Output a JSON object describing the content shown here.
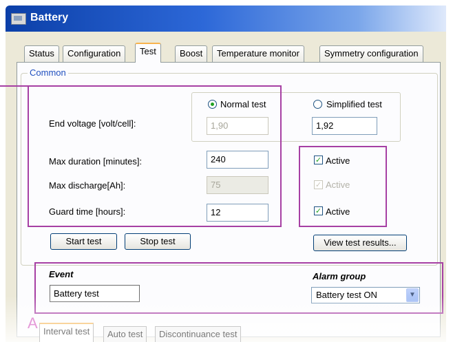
{
  "window": {
    "title": "Battery"
  },
  "tabs": [
    {
      "label": "Status"
    },
    {
      "label": "Configuration"
    },
    {
      "label": "Test"
    },
    {
      "label": "Boost"
    },
    {
      "label": "Temperature monitor"
    },
    {
      "label": "Symmetry configuration"
    }
  ],
  "active_tab": "Test",
  "common": {
    "group_label": "Common",
    "normal_test_label": "Normal test",
    "simplified_test_label": "Simplified test",
    "selected_mode": "Normal test",
    "end_voltage_label": "End voltage [volt/cell]:",
    "end_voltage_normal": "1,90",
    "end_voltage_simplified": "1,92",
    "max_duration_label": "Max duration [minutes]:",
    "max_duration_value": "240",
    "max_discharge_label": "Max discharge[Ah]:",
    "max_discharge_value": "75",
    "guard_time_label": "Guard time [hours]:",
    "guard_time_value": "12",
    "active_label": "Active",
    "checkboxes": [
      {
        "label": "Active",
        "checked": true,
        "enabled": true
      },
      {
        "label": "Active",
        "checked": true,
        "enabled": false
      },
      {
        "label": "Active",
        "checked": true,
        "enabled": true
      }
    ]
  },
  "buttons": {
    "start_test": "Start test",
    "stop_test": "Stop test",
    "view_results": "View test results..."
  },
  "event": {
    "header": "Event",
    "value": "Battery test",
    "alarm_header": "Alarm group",
    "alarm_value": "Battery test ON"
  },
  "annotation_marker": "A",
  "bottom_tabs": [
    {
      "label": "Interval test"
    },
    {
      "label": "Auto test"
    },
    {
      "label": "Discontinuance test"
    }
  ],
  "colors": {
    "titlebar": "#0b3fa8",
    "highlight": "#a63fa3",
    "group_label": "#1f4fbf"
  }
}
